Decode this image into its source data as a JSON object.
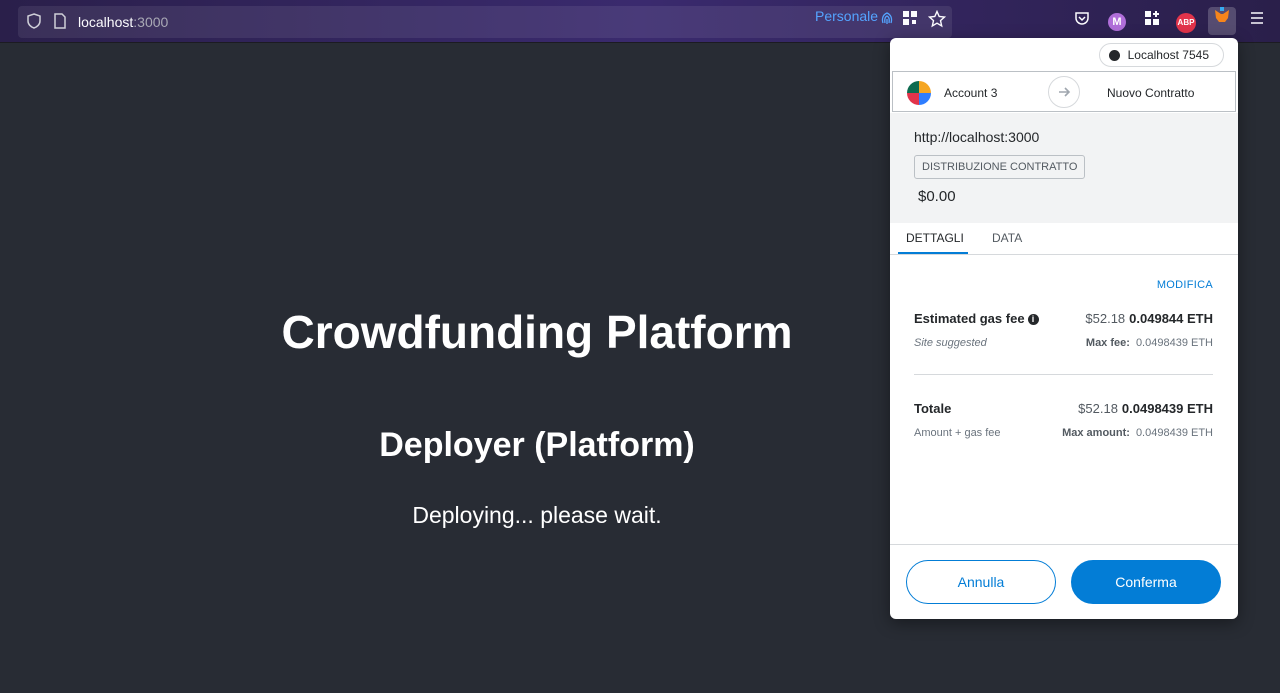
{
  "browser": {
    "url_host": "localhost",
    "url_port": ":3000",
    "profile_label": "Personale",
    "extension_m_label": "M",
    "extension_abp_label": "ABP"
  },
  "page": {
    "title": "Crowdfunding Platform",
    "subtitle": "Deployer (Platform)",
    "message": "Deploying... please wait."
  },
  "wallet": {
    "network": "Localhost 7545",
    "from_account": "Account 3",
    "to_label": "Nuovo Contratto",
    "origin": "http://localhost:3000",
    "action_tag": "DISTRIBUZIONE CONTRATTO",
    "value": "$0.00",
    "tabs": [
      {
        "label": "DETTAGLI",
        "active": true
      },
      {
        "label": "DATA",
        "active": false
      }
    ],
    "edit_label": "MODIFICA",
    "gas": {
      "label": "Estimated gas fee",
      "sub": "Site suggested",
      "fiat": "$52.18",
      "eth": "0.049844 ETH",
      "max_label": "Max fee:",
      "max_value": "0.0498439 ETH"
    },
    "total": {
      "label": "Totale",
      "sub": "Amount + gas fee",
      "fiat": "$52.18",
      "eth": "0.0498439 ETH",
      "max_label": "Max amount:",
      "max_value": "0.0498439 ETH"
    },
    "cancel_label": "Annulla",
    "confirm_label": "Conferma"
  },
  "colors": {
    "accent": "#037dd6",
    "page_bg": "#282c34"
  }
}
